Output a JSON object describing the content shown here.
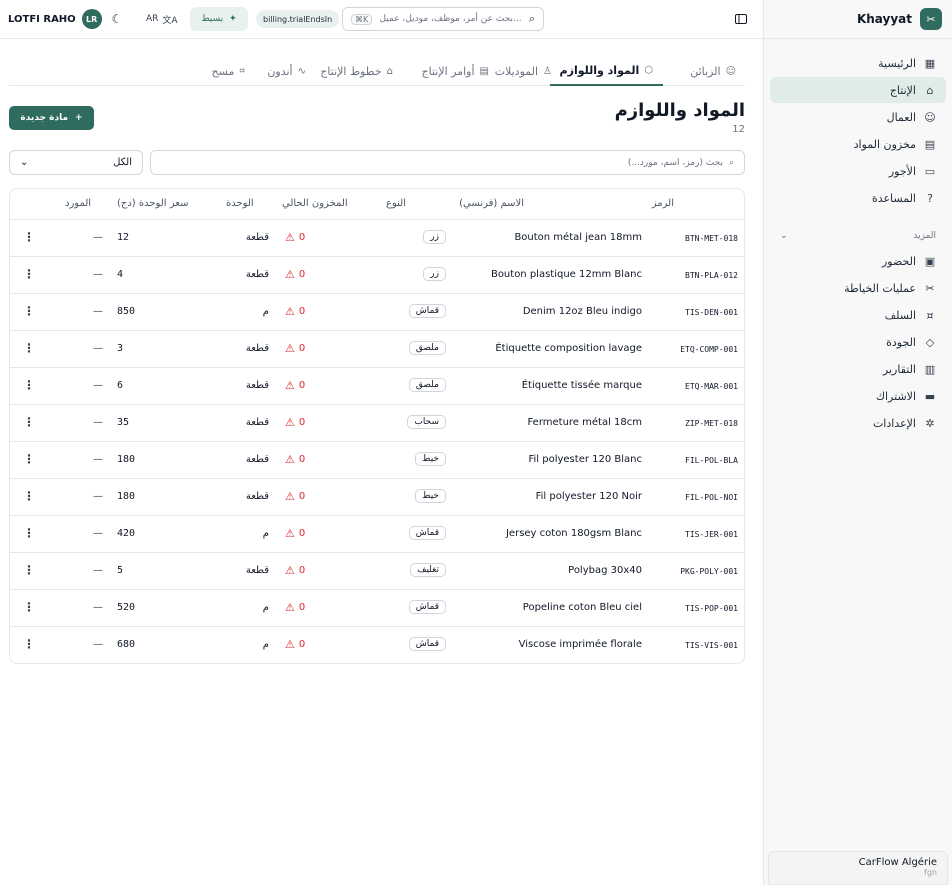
{
  "sidebar": {
    "brand": "Khayyat",
    "items": [
      {
        "label": "الرئيسية",
        "icon": "grid-icon",
        "glyph": "▦"
      },
      {
        "label": "الإنتاج",
        "icon": "factory-icon",
        "glyph": "⌂"
      },
      {
        "label": "العمال",
        "icon": "users-icon",
        "glyph": "☺"
      },
      {
        "label": "مخزون المواد",
        "icon": "warehouse-icon",
        "glyph": "▤"
      },
      {
        "label": "الأجور",
        "icon": "wallet-icon",
        "glyph": "▭"
      },
      {
        "label": "المساعدة",
        "icon": "help-icon",
        "glyph": "?"
      }
    ],
    "section_label": "المزيد",
    "more_items": [
      {
        "label": "الحضور",
        "icon": "calendar-icon",
        "glyph": "▣"
      },
      {
        "label": "عمليات الخياطة",
        "icon": "scissors-icon",
        "glyph": "✂"
      },
      {
        "label": "السلف",
        "icon": "hand-coins-icon",
        "glyph": "¤"
      },
      {
        "label": "الجودة",
        "icon": "shield-icon",
        "glyph": "◇"
      },
      {
        "label": "التقارير",
        "icon": "bar-chart-icon",
        "glyph": "▥"
      },
      {
        "label": "الاشتراك",
        "icon": "credit-card-icon",
        "glyph": "▬"
      },
      {
        "label": "الإعدادات",
        "icon": "gear-icon",
        "glyph": "✲"
      }
    ],
    "org": {
      "name": "CarFlow Algérie",
      "sub": "fgn"
    }
  },
  "topbar": {
    "user_name": "LOTFI RAHO",
    "avatar_initials": "LR",
    "lang": "AR",
    "plan": "بسيط",
    "trial": "billing.trialEndsIn",
    "search_placeholder": "بحث عن أمر، موظف، موديل، عميل...",
    "kbd": "⌘K"
  },
  "tabs": [
    {
      "label": "الزبائن",
      "active": false
    },
    {
      "label": "المواد واللوازم",
      "active": true
    },
    {
      "label": "الموديلات",
      "active": false
    },
    {
      "label": "أوامر الإنتاج",
      "active": false
    },
    {
      "label": "خطوط الإنتاج",
      "active": false
    },
    {
      "label": "أندون",
      "active": false
    },
    {
      "label": "مسح",
      "active": false
    }
  ],
  "page": {
    "title": "المواد واللوازم",
    "count": "12",
    "new_button": "مادة جديدة"
  },
  "filters": {
    "select_value": "الكل",
    "search_placeholder": "بحث (رمز، اسم، مورد...)"
  },
  "table": {
    "columns": {
      "code": "الرمز",
      "name": "الاسم (فرنسي)",
      "type": "النوع",
      "stock": "المخزون الحالي",
      "unit": "الوحدة",
      "price": "سعر الوحدة (دج)",
      "supplier": "المورد"
    },
    "rows": [
      {
        "code": "BTN-MET-018",
        "name": "Bouton métal jean 18mm",
        "type": "زر",
        "stock": "0",
        "unit": "قطعة",
        "price": "12",
        "supplier": "—"
      },
      {
        "code": "BTN-PLA-012",
        "name": "Bouton plastique 12mm Blanc",
        "type": "زر",
        "stock": "0",
        "unit": "قطعة",
        "price": "4",
        "supplier": "—"
      },
      {
        "code": "TIS-DEN-001",
        "name": "Denim 12oz Bleu indigo",
        "type": "قماش",
        "stock": "0",
        "unit": "م",
        "price": "850",
        "supplier": "—"
      },
      {
        "code": "ETQ-COMP-001",
        "name": "Étiquette composition lavage",
        "type": "ملصق",
        "stock": "0",
        "unit": "قطعة",
        "price": "3",
        "supplier": "—"
      },
      {
        "code": "ETQ-MAR-001",
        "name": "Étiquette tissée marque",
        "type": "ملصق",
        "stock": "0",
        "unit": "قطعة",
        "price": "6",
        "supplier": "—"
      },
      {
        "code": "ZIP-MET-018",
        "name": "Fermeture métal 18cm",
        "type": "سحاب",
        "stock": "0",
        "unit": "قطعة",
        "price": "35",
        "supplier": "—"
      },
      {
        "code": "FIL-POL-BLA",
        "name": "Fil polyester 120 Blanc",
        "type": "خيط",
        "stock": "0",
        "unit": "قطعة",
        "price": "180",
        "supplier": "—"
      },
      {
        "code": "FIL-POL-NOI",
        "name": "Fil polyester 120 Noir",
        "type": "خيط",
        "stock": "0",
        "unit": "قطعة",
        "price": "180",
        "supplier": "—"
      },
      {
        "code": "TIS-JER-001",
        "name": "Jersey coton 180gsm Blanc",
        "type": "قماش",
        "stock": "0",
        "unit": "م",
        "price": "420",
        "supplier": "—"
      },
      {
        "code": "PKG-POLY-001",
        "name": "Polybag 30x40",
        "type": "تغليف",
        "stock": "0",
        "unit": "قطعة",
        "price": "5",
        "supplier": "—"
      },
      {
        "code": "TIS-POP-001",
        "name": "Popeline coton Bleu ciel",
        "type": "قماش",
        "stock": "0",
        "unit": "م",
        "price": "520",
        "supplier": "—"
      },
      {
        "code": "TIS-VIS-001",
        "name": "Viscose imprimée florale",
        "type": "قماش",
        "stock": "0",
        "unit": "م",
        "price": "680",
        "supplier": "—"
      }
    ]
  },
  "colors": {
    "accent": "#2f6b5e",
    "accent_light": "#dfece8",
    "danger": "#dc2626"
  }
}
